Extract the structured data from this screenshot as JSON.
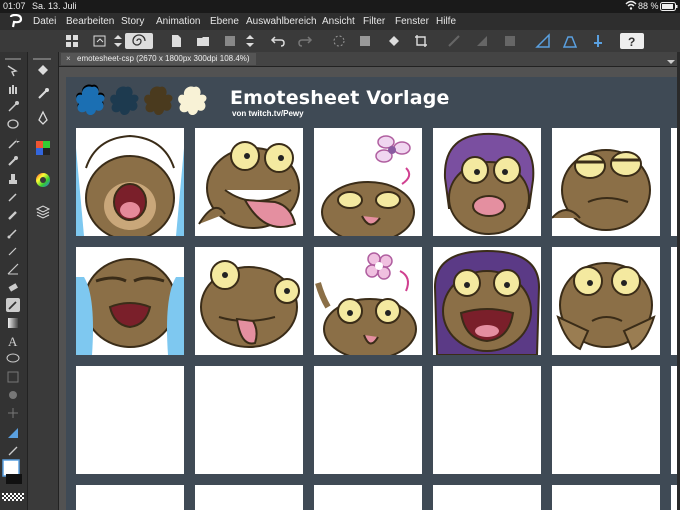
{
  "status": {
    "time": "01:07",
    "date": "Sa. 13. Juli",
    "battery": "88 %"
  },
  "menu": [
    "Datei",
    "Bearbeiten",
    "Story",
    "Animation",
    "Ebene",
    "Auswahlbereich",
    "Ansicht",
    "Filter",
    "Fenster",
    "Hilfe"
  ],
  "tab": {
    "label": "emotesheet-csp (2670 x 1800px 300dpi 108.4%)"
  },
  "sheet": {
    "title": "Emotesheet Vorlage",
    "subtitle": "von twitch.tv/Pewy"
  },
  "swatches": [
    "#1b6fb3",
    "#1d3a4f",
    "#4a3a1e",
    "#f8f2d6"
  ],
  "emotes_row1": [
    "crying-scream",
    "tongue-out",
    "blep-with-flower",
    "purple-hood-sad",
    "smug-thinking"
  ],
  "emotes_row2": [
    "blue-tears",
    "derp-tongue",
    "blep-cute",
    "purple-hood-angry",
    "hands-cheeks-worried"
  ]
}
